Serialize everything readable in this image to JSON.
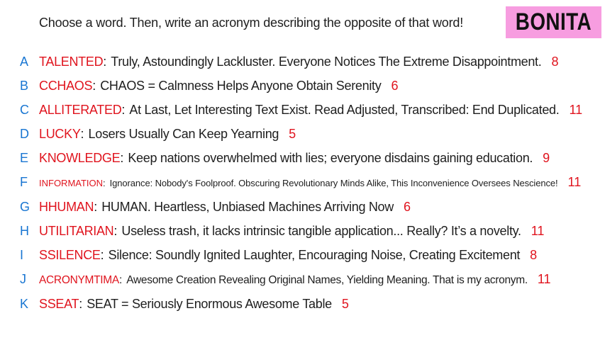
{
  "prompt": "Choose a word. Then, write an acronym describing the opposite of that word!",
  "name_badge": {
    "text": "BONITA",
    "color": "#f79de0"
  },
  "colors": {
    "letter": "#1976d2",
    "word": "#e0141e",
    "score": "#e0141e",
    "text": "#1e1e1e"
  },
  "entries": [
    {
      "letter": "A",
      "word": "TALENTED",
      "acronym": "Truly, Astoundingly Lackluster. Everyone Notices The Extreme Disappointment.",
      "score": "8"
    },
    {
      "letter": "B",
      "word": "CCHAOS",
      "acronym": "CHAOS = Calmness Helps Anyone Obtain Serenity",
      "score": "6"
    },
    {
      "letter": "C",
      "word": "ALLITERATED",
      "acronym": "At Last, Let Interesting Text Exist. Read Adjusted, Transcribed: End Duplicated.",
      "score": "11"
    },
    {
      "letter": "D",
      "word": "LUCKY",
      "acronym": "Losers Usually Can Keep Yearning",
      "score": "5"
    },
    {
      "letter": "E",
      "word": "KNOWLEDGE",
      "acronym": "Keep nations overwhelmed with lies; everyone disdains gaining education.",
      "score": "9"
    },
    {
      "letter": "F",
      "word": "INFORMATION",
      "acronym": "Ignorance: Nobody's Foolproof. Obscuring Revolutionary Minds Alike, This Inconvenience Oversees Nescience!",
      "score": "11"
    },
    {
      "letter": "G",
      "word": "HHUMAN",
      "acronym": "HUMAN. Heartless, Unbiased Machines Arriving Now",
      "score": "6"
    },
    {
      "letter": "H",
      "word": "UTILITARIAN",
      "acronym": "Useless trash, it lacks intrinsic tangible application... Really? It’s a novelty.",
      "score": "11"
    },
    {
      "letter": "I",
      "word": "SSILENCE",
      "acronym": "Silence: Soundly Ignited Laughter, Encouraging Noise, Creating Excitement",
      "score": "8"
    },
    {
      "letter": "J",
      "word": "ACRONYMTIMA",
      "acronym": "Awesome Creation Revealing Original Names, Yielding Meaning. That is my acronym.",
      "score": "11"
    },
    {
      "letter": "K",
      "word": "SSEAT",
      "acronym": "SEAT = Seriously Enormous Awesome Table",
      "score": "5"
    }
  ]
}
